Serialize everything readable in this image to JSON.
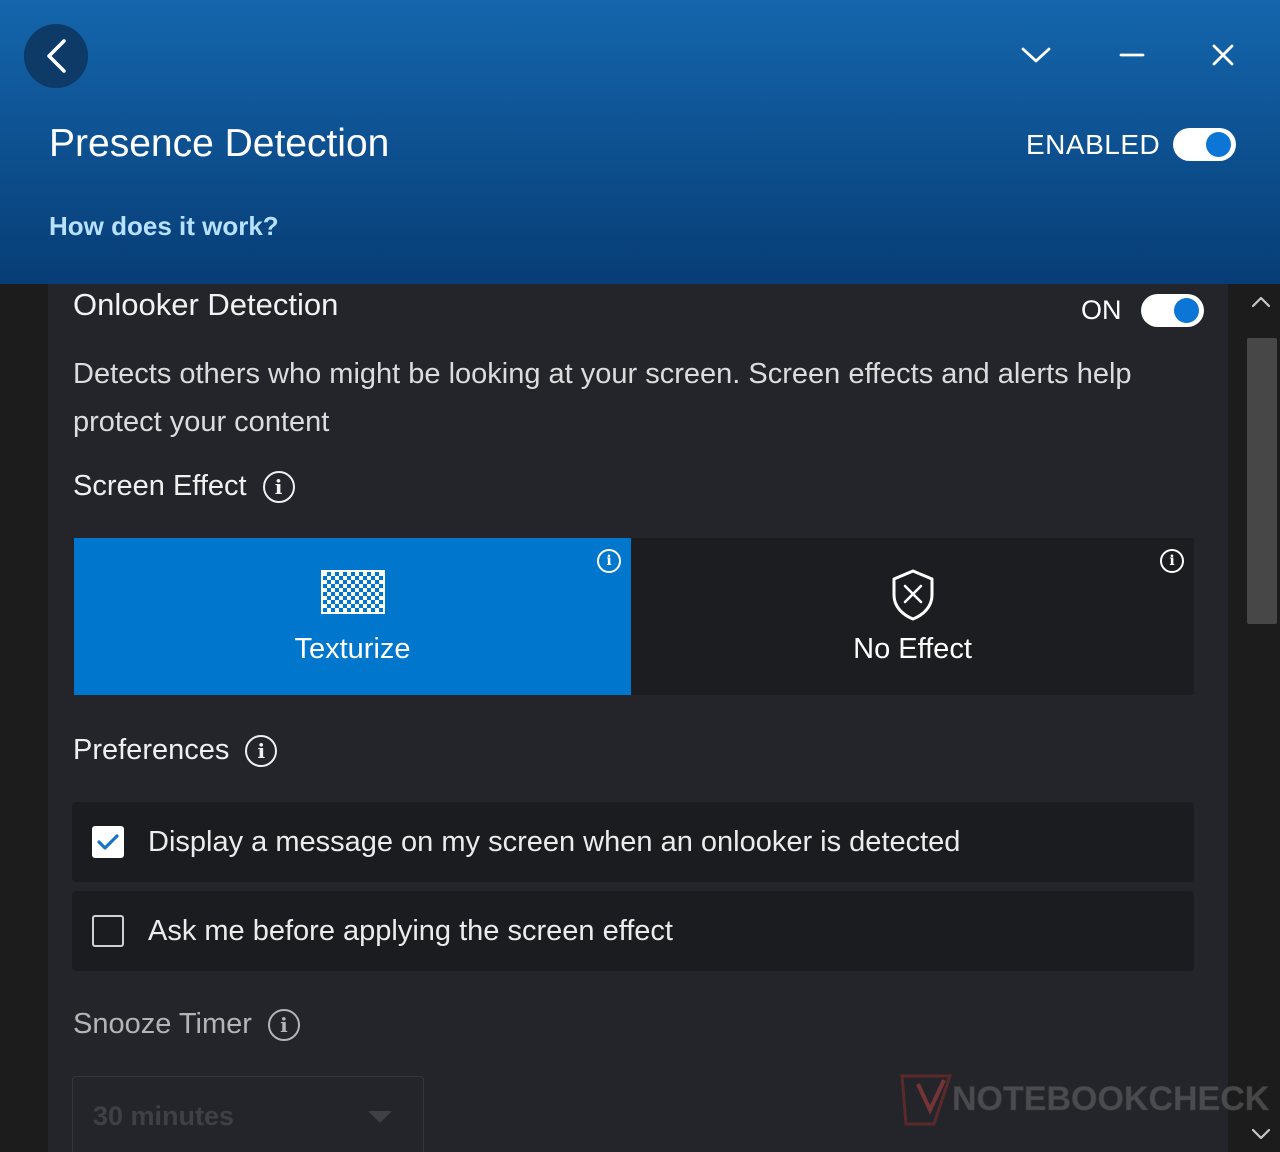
{
  "header": {
    "title": "Presence Detection",
    "enabled_label": "ENABLED",
    "enabled": true,
    "help_link": "How does it work?",
    "colors": {
      "header_top": "#1466ad",
      "header_bottom": "#073d76",
      "link": "#b8e0ff"
    }
  },
  "window_controls": {
    "back_icon": "chevron-left-icon",
    "dropdown_icon": "chevron-down-icon",
    "minimize_icon": "minimize-icon",
    "close_icon": "close-icon"
  },
  "onlooker": {
    "title": "Onlooker Detection",
    "toggle_label": "ON",
    "toggle_on": true,
    "description": "Detects others who might be looking at your screen. Screen effects and alerts help protect your content"
  },
  "screen_effect": {
    "heading": "Screen Effect",
    "options": [
      {
        "label": "Texturize",
        "icon": "checkerboard-icon",
        "selected": true
      },
      {
        "label": "No Effect",
        "icon": "shield-x-icon",
        "selected": false
      }
    ],
    "accent": "#0077cc"
  },
  "preferences": {
    "heading": "Preferences",
    "items": [
      {
        "label": "Display a message on my screen when an onlooker is detected",
        "checked": true
      },
      {
        "label": "Ask me before applying the screen effect",
        "checked": false
      }
    ]
  },
  "snooze": {
    "heading": "Snooze Timer",
    "selected": "30 minutes",
    "disabled": true
  },
  "watermark": {
    "text": "NOTEBOOKCHECK"
  }
}
